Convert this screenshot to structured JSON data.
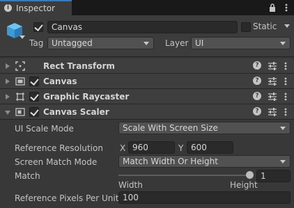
{
  "window": {
    "tab_label": "Inspector",
    "tab_icon": "info-icon"
  },
  "gameobject": {
    "name": "Canvas",
    "active": true,
    "static_label": "Static",
    "static": false,
    "tag_label": "Tag",
    "tag_value": "Untagged",
    "layer_label": "Layer",
    "layer_value": "UI"
  },
  "components": [
    {
      "title": "Rect Transform",
      "icon": "rect-transform-icon",
      "expanded": false,
      "has_checkbox": false
    },
    {
      "title": "Canvas",
      "icon": "canvas-icon",
      "expanded": false,
      "has_checkbox": true,
      "enabled": true
    },
    {
      "title": "Graphic Raycaster",
      "icon": "raycaster-icon",
      "expanded": false,
      "has_checkbox": true,
      "enabled": true
    },
    {
      "title": "Canvas Scaler",
      "icon": "canvas-scaler-icon",
      "expanded": true,
      "has_checkbox": true,
      "enabled": true
    }
  ],
  "canvas_scaler": {
    "ui_scale_mode_label": "UI Scale Mode",
    "ui_scale_mode_value": "Scale With Screen Size",
    "reference_resolution_label": "Reference Resolution",
    "x_label": "X",
    "x_value": "960",
    "y_label": "Y",
    "y_value": "600",
    "screen_match_mode_label": "Screen Match Mode",
    "screen_match_mode_value": "Match Width Or Height",
    "match_label": "Match",
    "match_value": "1",
    "match_fraction": 1,
    "match_min_label": "Width",
    "match_max_label": "Height",
    "ref_pixels_label": "Reference Pixels Per Unit",
    "ref_pixels_value": "100"
  },
  "colors": {
    "accent": "#3a79bb",
    "background": "#383838",
    "header": "#3e3e3e"
  }
}
